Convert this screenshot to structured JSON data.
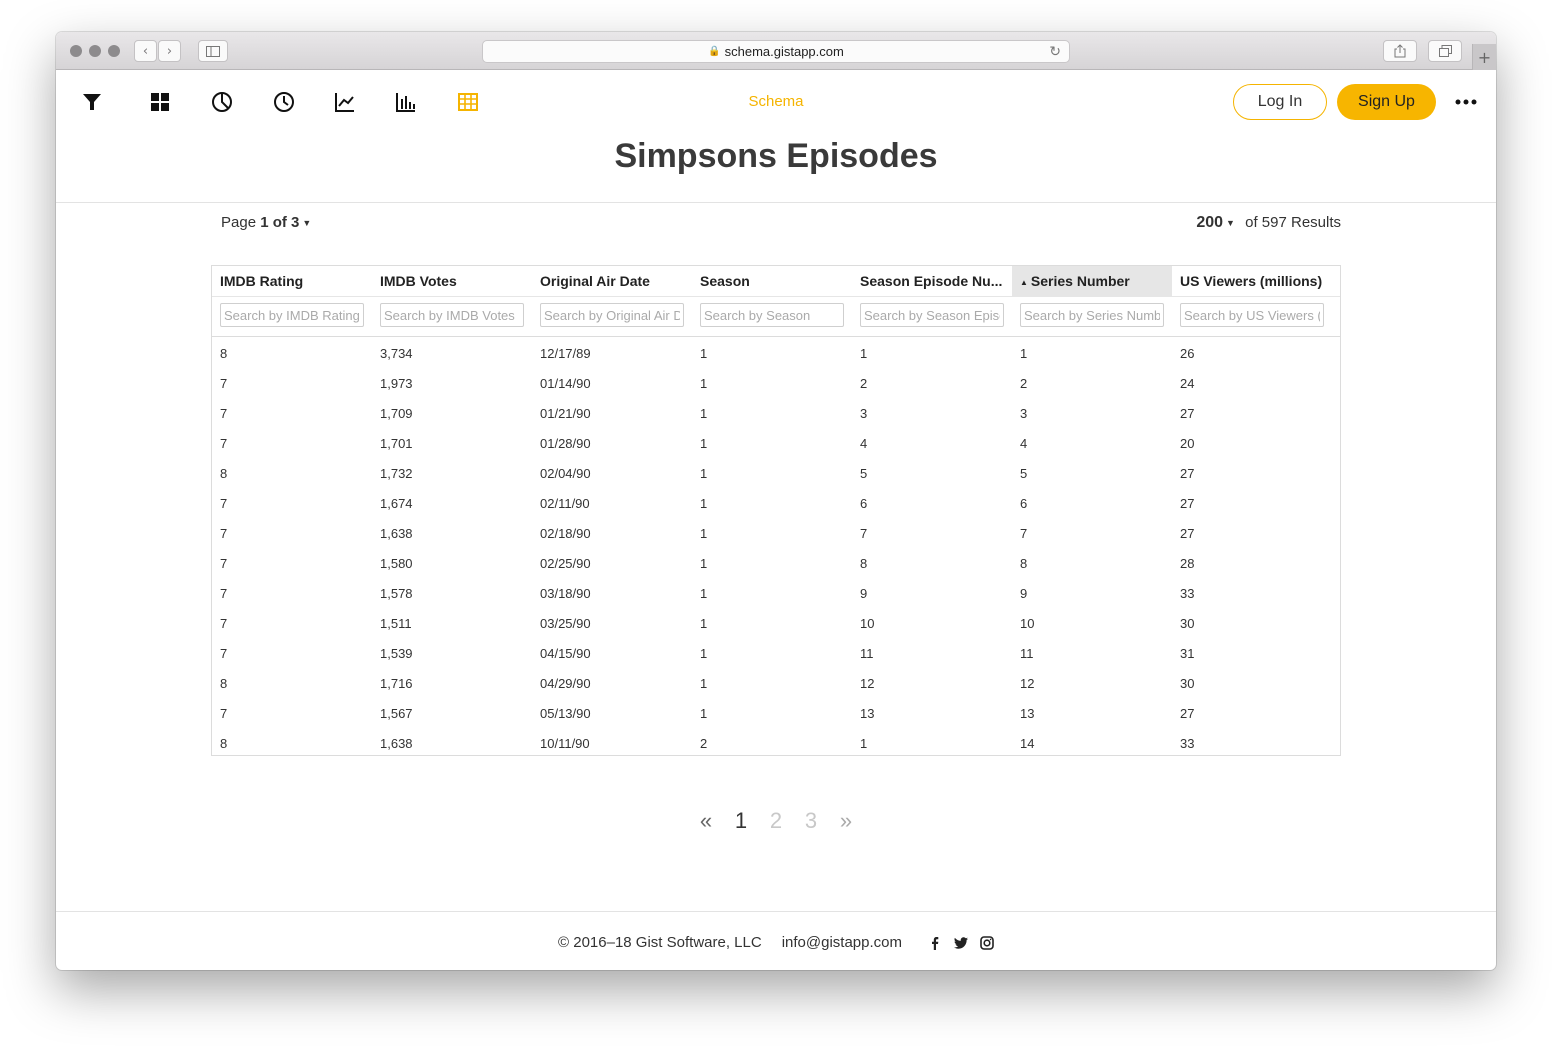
{
  "browser": {
    "url": "schema.gistapp.com"
  },
  "header": {
    "brand": "Schema",
    "login_label": "Log In",
    "signup_label": "Sign Up",
    "tools": [
      "filter-icon",
      "grid-icon",
      "pie-chart-icon",
      "clock-icon",
      "line-chart-icon",
      "bar-chart-icon",
      "table-icon"
    ],
    "accent_color": "#f5b400"
  },
  "page": {
    "title": "Simpsons Episodes"
  },
  "pager": {
    "page_prefix": "Page",
    "page_value": "1 of 3",
    "page_size": "200",
    "results_suffix": "of 597 Results"
  },
  "table": {
    "columns": [
      {
        "label": "IMDB Rating",
        "placeholder": "Search by IMDB Rating"
      },
      {
        "label": "IMDB Votes",
        "placeholder": "Search by IMDB Votes"
      },
      {
        "label": "Original Air Date",
        "placeholder": "Search by Original Air Date"
      },
      {
        "label": "Season",
        "placeholder": "Search by Season"
      },
      {
        "label": "Season Episode Nu...",
        "placeholder": "Search by Season Episode Number"
      },
      {
        "label": "Series Number",
        "placeholder": "Search by Series Number"
      },
      {
        "label": "US Viewers (millions)",
        "placeholder": "Search by US Viewers (millions)"
      }
    ],
    "rows": [
      [
        "8",
        "3,734",
        "12/17/89",
        "1",
        "1",
        "1",
        "26"
      ],
      [
        "7",
        "1,973",
        "01/14/90",
        "1",
        "2",
        "2",
        "24"
      ],
      [
        "7",
        "1,709",
        "01/21/90",
        "1",
        "3",
        "3",
        "27"
      ],
      [
        "7",
        "1,701",
        "01/28/90",
        "1",
        "4",
        "4",
        "20"
      ],
      [
        "8",
        "1,732",
        "02/04/90",
        "1",
        "5",
        "5",
        "27"
      ],
      [
        "7",
        "1,674",
        "02/11/90",
        "1",
        "6",
        "6",
        "27"
      ],
      [
        "7",
        "1,638",
        "02/18/90",
        "1",
        "7",
        "7",
        "27"
      ],
      [
        "7",
        "1,580",
        "02/25/90",
        "1",
        "8",
        "8",
        "28"
      ],
      [
        "7",
        "1,578",
        "03/18/90",
        "1",
        "9",
        "9",
        "33"
      ],
      [
        "7",
        "1,511",
        "03/25/90",
        "1",
        "10",
        "10",
        "30"
      ],
      [
        "7",
        "1,539",
        "04/15/90",
        "1",
        "11",
        "11",
        "31"
      ],
      [
        "8",
        "1,716",
        "04/29/90",
        "1",
        "12",
        "12",
        "30"
      ],
      [
        "7",
        "1,567",
        "05/13/90",
        "1",
        "13",
        "13",
        "27"
      ],
      [
        "8",
        "1,638",
        "10/11/90",
        "2",
        "1",
        "14",
        "33"
      ]
    ]
  },
  "pagination": {
    "prev": "«",
    "pages": [
      "1",
      "2",
      "3"
    ],
    "next": "»"
  },
  "footer": {
    "copyright": "© 2016–18 Gist Software, LLC",
    "email": "info@gistapp.com"
  }
}
